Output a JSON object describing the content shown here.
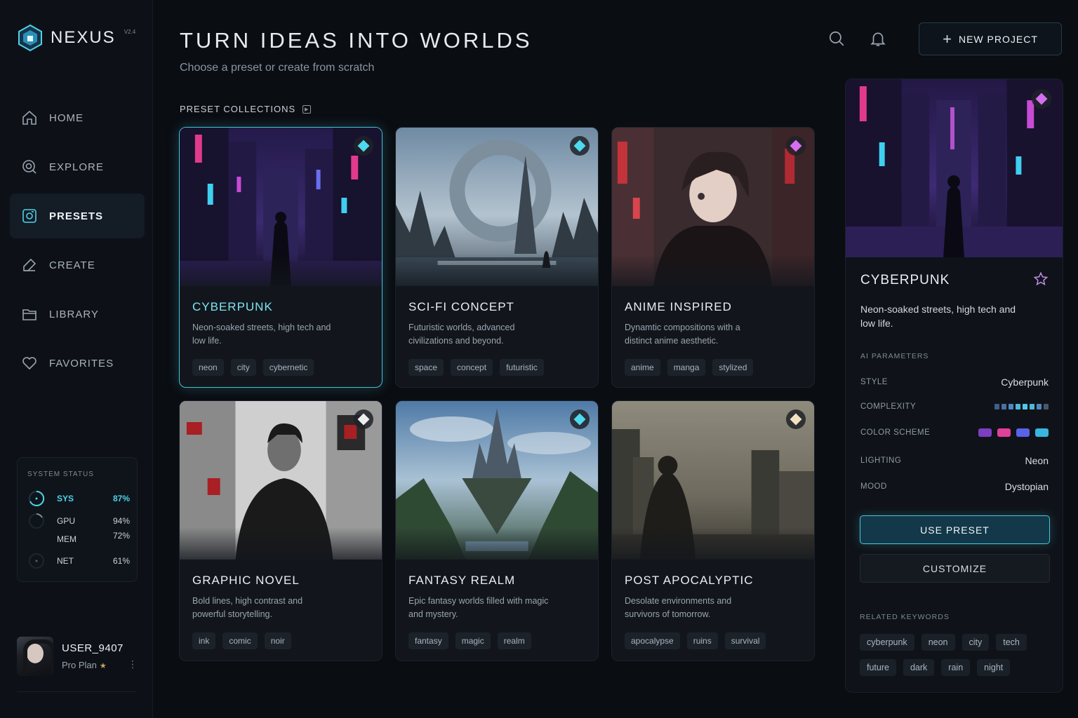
{
  "brand": {
    "name": "NEXUS",
    "version": "V2.4"
  },
  "nav": [
    {
      "label": "HOME",
      "icon": "home-icon"
    },
    {
      "label": "EXPLORE",
      "icon": "explore-icon"
    },
    {
      "label": "PRESETS",
      "icon": "presets-icon",
      "active": true
    },
    {
      "label": "CREATE",
      "icon": "edit-icon"
    },
    {
      "label": "LIBRARY",
      "icon": "folder-icon"
    },
    {
      "label": "FAVORITES",
      "icon": "heart-icon"
    }
  ],
  "system_status": {
    "title": "SYSTEM STATUS",
    "rows": [
      {
        "name": "SYS",
        "value": "87%"
      },
      {
        "name": "GPU",
        "value": "94%"
      },
      {
        "name": "MEM",
        "value": "72%"
      },
      {
        "name": "NET",
        "value": "61%"
      }
    ]
  },
  "user": {
    "name": "USER_9407",
    "plan": "Pro Plan"
  },
  "header": {
    "title": "TURN IDEAS INTO WORLDS",
    "subtitle": "Choose a preset or create from scratch",
    "new_project": "NEW PROJECT"
  },
  "section": {
    "label": "PRESET COLLECTIONS"
  },
  "presets": [
    {
      "title": "CYBERPUNK",
      "desc": "Neon-soaked streets, high tech and low life.",
      "tags": [
        "neon",
        "city",
        "cybernetic"
      ],
      "gem_color": "#4fd8ee"
    },
    {
      "title": "SCI-FI CONCEPT",
      "desc": "Futuristic worlds, advanced civilizations and beyond.",
      "tags": [
        "space",
        "concept",
        "futuristic"
      ],
      "gem_color": "#4fd8ee"
    },
    {
      "title": "ANIME INSPIRED",
      "desc": "Dynamtic compositions with a distinct anime aesthetic.",
      "tags": [
        "anime",
        "manga",
        "stylized"
      ],
      "gem_color": "#d56ef0"
    },
    {
      "title": "GRAPHIC NOVEL",
      "desc": "Bold lines, high contrast and powerful storytelling.",
      "tags": [
        "ink",
        "comic",
        "noir"
      ],
      "gem_color": "#eeeeee"
    },
    {
      "title": "FANTASY REALM",
      "desc": "Epic fantasy worlds filled with magic and mystery.",
      "tags": [
        "fantasy",
        "magic",
        "realm"
      ],
      "gem_color": "#4fd8ee"
    },
    {
      "title": "POST APOCALYPTIC",
      "desc": "Desolate environments and survivors of tomorrow.",
      "tags": [
        "apocalypse",
        "ruins",
        "survival"
      ],
      "gem_color": "#f3e2c0"
    }
  ],
  "detail": {
    "title": "CYBERPUNK",
    "desc": "Neon-soaked streets, high tech and low life.",
    "params_label": "AI PARAMETERS",
    "params": {
      "style": {
        "label": "STYLE",
        "value": "Cyberpunk"
      },
      "complexity": {
        "label": "COMPLEXITY",
        "level": 5,
        "max": 8
      },
      "color_scheme": {
        "label": "COLOR SCHEME",
        "colors": [
          "#7b3fbf",
          "#e0409a",
          "#5a62e8",
          "#39b6e0"
        ]
      },
      "lighting": {
        "label": "LIGHTING",
        "value": "Neon"
      },
      "mood": {
        "label": "MOOD",
        "value": "Dystopian"
      }
    },
    "use_preset": "USE PRESET",
    "customize": "CUSTOMIZE",
    "keywords_label": "RELATED KEYWORDS",
    "keywords": [
      "cyberpunk",
      "neon",
      "city",
      "tech",
      "future",
      "dark",
      "rain",
      "night"
    ]
  },
  "colors": {
    "accent": "#4fd1e8",
    "background": "#0a0d12"
  }
}
